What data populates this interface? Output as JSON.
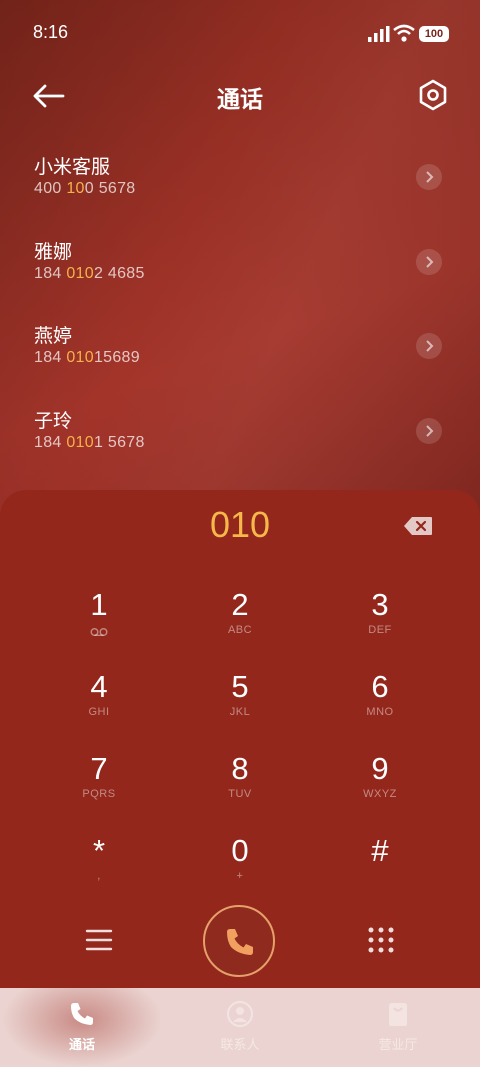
{
  "status": {
    "time": "8:16",
    "battery": "100"
  },
  "header": {
    "title": "通话"
  },
  "contacts": [
    {
      "name": "小米客服",
      "num_pre": "400 ",
      "num_hl": "10",
      "num_post": "0 5678"
    },
    {
      "name": "雅娜",
      "num_pre": "184 ",
      "num_hl": "010",
      "num_post": "2 4685"
    },
    {
      "name": "燕婷",
      "num_pre": "184 ",
      "num_hl": "010",
      "num_post": "15689"
    },
    {
      "name": "子玲",
      "num_pre": "184 ",
      "num_hl": "010",
      "num_post": "1 5678"
    }
  ],
  "dialer": {
    "entered": "010",
    "keys": [
      {
        "digit": "1",
        "letters": "oo"
      },
      {
        "digit": "2",
        "letters": "ABC"
      },
      {
        "digit": "3",
        "letters": "DEF"
      },
      {
        "digit": "4",
        "letters": "GHI"
      },
      {
        "digit": "5",
        "letters": "JKL"
      },
      {
        "digit": "6",
        "letters": "MNO"
      },
      {
        "digit": "7",
        "letters": "PQRS"
      },
      {
        "digit": "8",
        "letters": "TUV"
      },
      {
        "digit": "9",
        "letters": "WXYZ"
      },
      {
        "digit": "*",
        "letters": ","
      },
      {
        "digit": "0",
        "letters": "+"
      },
      {
        "digit": "#",
        "letters": ""
      }
    ]
  },
  "tabs": [
    {
      "label": "通话",
      "icon": "phone-icon"
    },
    {
      "label": "联系人",
      "icon": "person-icon"
    },
    {
      "label": "营业厅",
      "icon": "shopping-bag-icon"
    }
  ],
  "colors": {
    "accent": "#f6b84a",
    "background": "#93271c",
    "tabbar": "#ead3d0"
  }
}
